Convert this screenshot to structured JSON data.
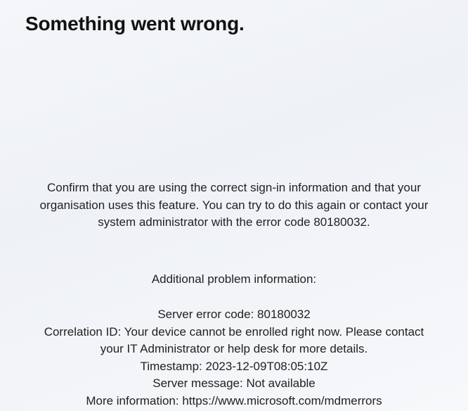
{
  "title": "Something went wrong.",
  "message": "Confirm that you are using the correct sign-in information and that your organisation uses this feature. You can try to do this again or contact your system administrator with the error code 80180032.",
  "info_heading": "Additional problem information:",
  "details": {
    "server_error_code_label": "Server error code:",
    "server_error_code_value": "80180032",
    "correlation_id_label": "Correlation ID:",
    "correlation_id_value": "Your device cannot be enrolled right now. Please contact your IT Administrator or help desk for more details.",
    "timestamp_label": "Timestamp:",
    "timestamp_value": "2023-12-09T08:05:10Z",
    "server_message_label": "Server message:",
    "server_message_value": "Not available",
    "more_info_label": "More information:",
    "more_info_value": "https://www.microsoft.com/mdmerrors"
  }
}
